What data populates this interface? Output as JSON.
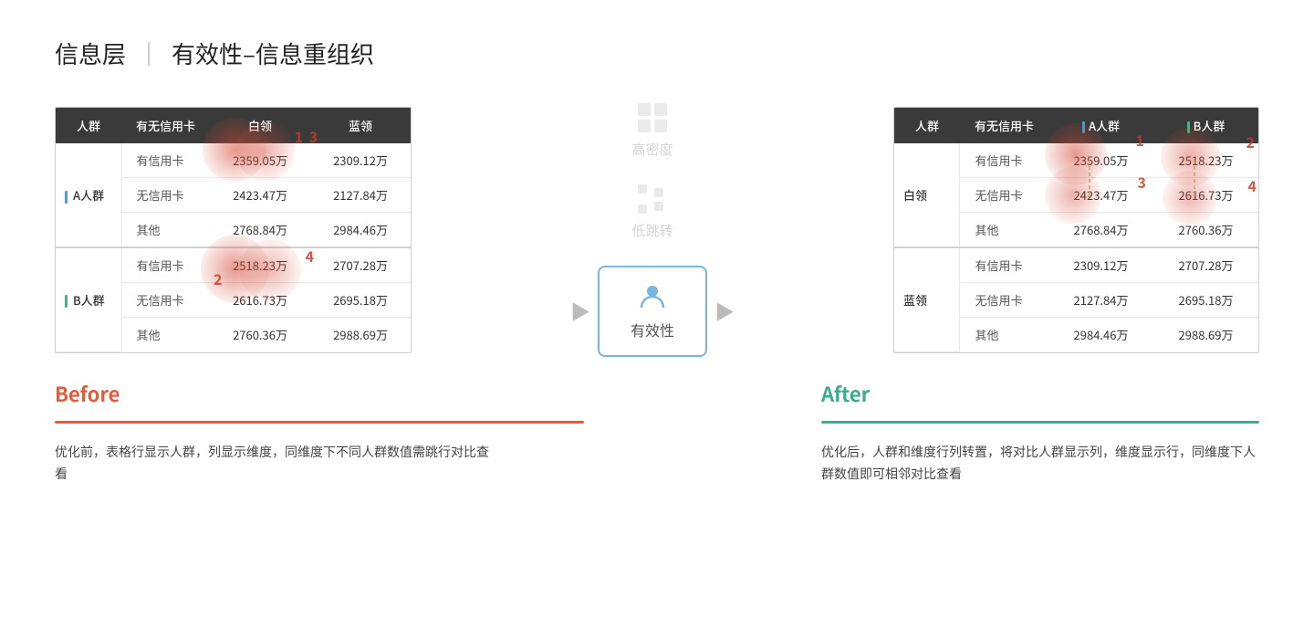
{
  "page": {
    "title": "信息层",
    "divider": "｜",
    "subtitle": "有效性–信息重组织"
  },
  "before_table": {
    "headers": [
      "人群",
      "有无信用卡",
      "白领",
      "蓝领"
    ],
    "group_a": {
      "label": "A人群",
      "color": "blue",
      "rows": [
        [
          "有信用卡",
          "2359.05万",
          "2309.12万"
        ],
        [
          "无信用卡",
          "2423.47万",
          "2127.84万"
        ],
        [
          "其他",
          "2768.84万",
          "2984.46万"
        ]
      ]
    },
    "group_b": {
      "label": "B人群",
      "color": "green",
      "rows": [
        [
          "有信用卡",
          "2518.23万",
          "2707.28万"
        ],
        [
          "无信用卡",
          "2616.73万",
          "2695.18万"
        ],
        [
          "其他",
          "2760.36万",
          "2988.69万"
        ]
      ]
    }
  },
  "middle": {
    "high_density_label": "高密度",
    "low_jump_label": "低跳转",
    "effectiveness_label": "有效性",
    "arrow_left": "▶",
    "arrow_right": "▶"
  },
  "after_table": {
    "headers": [
      "人群",
      "有无信用卡",
      "A人群",
      "B人群"
    ],
    "group_bailing": {
      "label": "白领",
      "rows": [
        [
          "有信用卡",
          "2359.05万",
          "2518.23万"
        ],
        [
          "无信用卡",
          "2423.47万",
          "2616.73万"
        ],
        [
          "其他",
          "2768.84万",
          "2760.36万"
        ]
      ]
    },
    "group_lanling": {
      "label": "蓝领",
      "rows": [
        [
          "有信用卡",
          "2309.12万",
          "2707.28万"
        ],
        [
          "无信用卡",
          "2127.84万",
          "2695.18万"
        ],
        [
          "其他",
          "2984.46万",
          "2988.69万"
        ]
      ]
    }
  },
  "before": {
    "title": "Before",
    "desc": "优化前，表格行显示人群，列显示维度，同维度下不同人群数值需跳行对比查看"
  },
  "after": {
    "title": "After",
    "desc": "优化后，人群和维度行列转置，将对比人群显示列，维度显示行，同维度下人群数值即可相邻对比查看"
  },
  "hotspots": {
    "before": [
      {
        "id": 1,
        "label": "1"
      },
      {
        "id": 2,
        "label": "2"
      },
      {
        "id": 3,
        "label": "3"
      },
      {
        "id": 4,
        "label": "4"
      }
    ],
    "after": [
      {
        "id": 1,
        "label": "1"
      },
      {
        "id": 2,
        "label": "2"
      },
      {
        "id": 3,
        "label": "3"
      },
      {
        "id": 4,
        "label": "4"
      }
    ]
  }
}
